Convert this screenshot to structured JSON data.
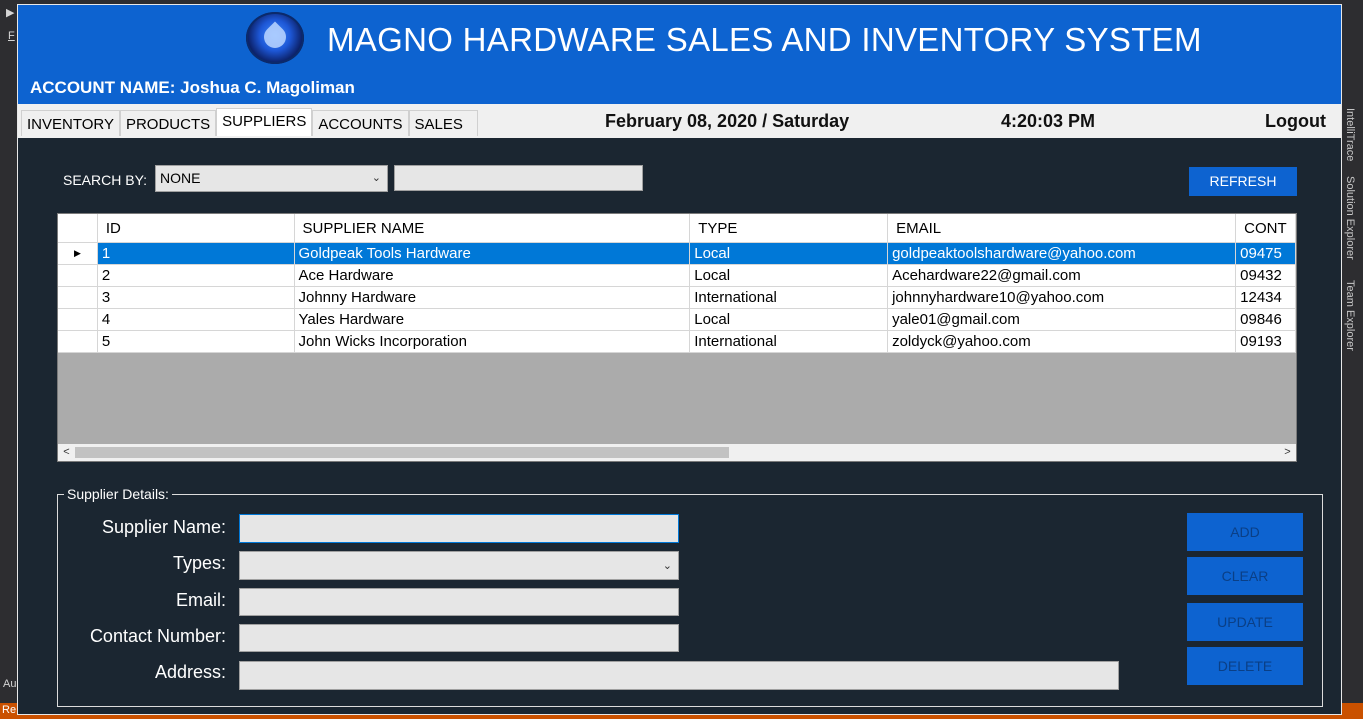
{
  "app": {
    "title": "MAGNO HARDWARE SALES AND INVENTORY SYSTEM",
    "account_label": "ACCOUNT NAME: Joshua C. Magoliman"
  },
  "ide": {
    "left_glyph": "▶",
    "left_glyph2": "F",
    "left_bottom": "Au",
    "bottom_status": "Re",
    "right_tabs": [
      "IntelliTrace",
      "Solution Explorer",
      "Team Explorer"
    ]
  },
  "nav": {
    "tabs": [
      "INVENTORY",
      "PRODUCTS",
      "SUPPLIERS",
      "ACCOUNTS",
      "SALES"
    ],
    "active_tab": "SUPPLIERS",
    "date": "February 08, 2020 / Saturday",
    "time": "4:20:03 PM",
    "logout": "Logout"
  },
  "search": {
    "label": "SEARCH BY:",
    "selected": "NONE",
    "value": "",
    "refresh_label": "REFRESH"
  },
  "table": {
    "columns": [
      "ID",
      "SUPPLIER NAME",
      "TYPE",
      "EMAIL",
      "CONT"
    ],
    "rows": [
      [
        "1",
        "Goldpeak Tools Hardware",
        "Local",
        "goldpeaktoolshardware@yahoo.com",
        "09475"
      ],
      [
        "2",
        "Ace Hardware",
        "Local",
        "Acehardware22@gmail.com",
        "09432"
      ],
      [
        "3",
        "Johnny Hardware",
        "International",
        "johnnyhardware10@yahoo.com",
        "12434"
      ],
      [
        "4",
        "Yales Hardware",
        "Local",
        "yale01@gmail.com",
        "09846"
      ],
      [
        "5",
        "John Wicks Incorporation",
        "International",
        "zoldyck@yahoo.com",
        "09193"
      ]
    ],
    "selected_row": 0,
    "row_indicator": "▶",
    "scroll_left": "<",
    "scroll_right": ">"
  },
  "details": {
    "group_label": "Supplier Details:",
    "labels": {
      "name": "Supplier Name:",
      "types": "Types:",
      "email": "Email:",
      "contact": "Contact Number:",
      "address": "Address:"
    },
    "buttons": {
      "add": "ADD",
      "clear": "CLEAR",
      "update": "UPDATE",
      "delete": "DELETE"
    }
  },
  "colors": {
    "header_blue": "#0d63d0",
    "panel_dark": "#1b2631",
    "selection": "#0078d7"
  }
}
